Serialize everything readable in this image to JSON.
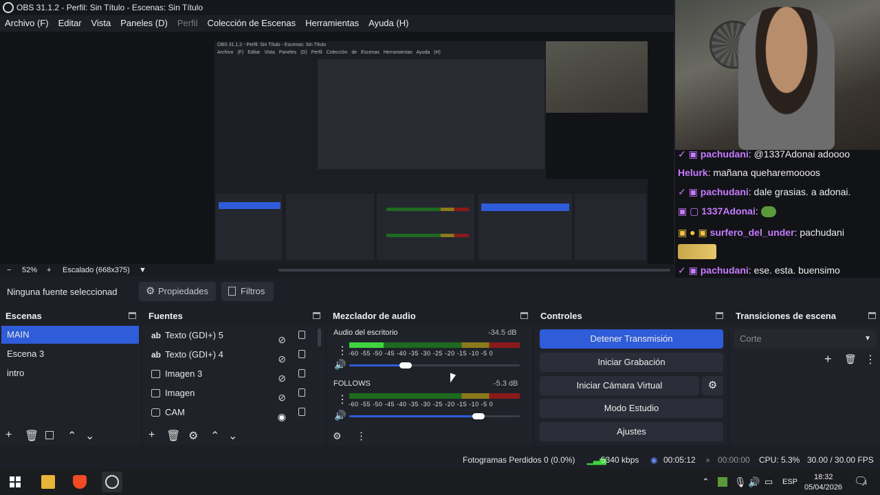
{
  "window": {
    "title": "OBS 31.1.2 - Perfil: Sin Título - Escenas: Sin Título"
  },
  "menu": [
    "Archivo (F)",
    "Editar",
    "Vista",
    "Paneles (D)",
    "Perfil",
    "Colección de Escenas",
    "Herramientas",
    "Ayuda (H)"
  ],
  "preview": {
    "zoom": "52%",
    "scale": "Escalado (668x375)",
    "nested_title": "OBS 31.1.2 - Perfil: Sin Título - Escenas: Sin Título",
    "nested_menu": [
      "Archivo (F)",
      "Editar",
      "Vista",
      "Paneles (D)",
      "Perfil",
      "Colección de Escenas",
      "Herramientas",
      "Ayuda (H)"
    ]
  },
  "chat": [
    {
      "user": "pachudani",
      "color": "#c77bff",
      "text": "@1337Adonai adoooo"
    },
    {
      "user": "Helurk",
      "color": "#c77bff",
      "text": "mañana queharemoooos"
    },
    {
      "user": "pachudani",
      "color": "#c77bff",
      "text": "dale grasias. a adonai."
    },
    {
      "user": "1337Adonai",
      "color": "#c77bff",
      "text": ""
    },
    {
      "user": "surfero_del_under",
      "color": "#c77bff",
      "text": "pachudani"
    },
    {
      "user": "pachudani",
      "color": "#c77bff",
      "text": "ese. esta. buensimo"
    }
  ],
  "props": {
    "no_source": "Ninguna fuente seleccionad",
    "properties": "Propiedades",
    "filters": "Filtros"
  },
  "scenes": {
    "title": "Escenas",
    "items": [
      "MAIN",
      "Escena 3",
      "intro"
    ],
    "selected": "MAIN"
  },
  "sources": {
    "title": "Fuentes",
    "items": [
      {
        "name": "Texto (GDI+) 5",
        "icon": "text-icon",
        "visible": false
      },
      {
        "name": "Texto (GDI+) 4",
        "icon": "text-icon",
        "visible": false
      },
      {
        "name": "Imagen 3",
        "icon": "image-icon",
        "visible": false
      },
      {
        "name": "Imagen",
        "icon": "image-icon",
        "visible": false
      },
      {
        "name": "CAM",
        "icon": "camera-icon",
        "visible": true
      }
    ]
  },
  "mixer": {
    "title": "Mezclador de audio",
    "ticks": "-60 -55 -50 -45 -40 -35 -30 -25 -20 -15 -10 -5 0",
    "channels": [
      {
        "name": "Audio del escritorio",
        "db": "-34.5 dB",
        "level": 0.2,
        "volume": 0.33
      },
      {
        "name": "FOLLOWS",
        "db": "-5.3 dB",
        "level": 0.0,
        "volume": 0.76
      }
    ]
  },
  "controls": {
    "title": "Controles",
    "stop_stream": "Detener Transmisión",
    "start_recording": "Iniciar Grabación",
    "virtual_cam": "Iniciar Cámara Virtual",
    "studio_mode": "Modo Estudio",
    "settings": "Ajustes"
  },
  "transitions": {
    "title": "Transiciones de escena",
    "selected": "Corte"
  },
  "status": {
    "dropped": "Fotogramas Perdidos 0 (0.0%)",
    "bitrate": "5340 kbps",
    "stream_time": "00:05:12",
    "rec_time": "00:00:00",
    "cpu": "CPU: 5.3%",
    "fps": "30.00 / 30.00 FPS"
  },
  "taskbar": {
    "lang": "ESP",
    "time": "18:32",
    "date": "05/04/2026",
    "notifications": "4"
  },
  "colors": {
    "accent": "#2f5cd8",
    "panel": "#20222a",
    "meter_green": "#3fd43f",
    "bitrate_green": "#3fd43f"
  }
}
